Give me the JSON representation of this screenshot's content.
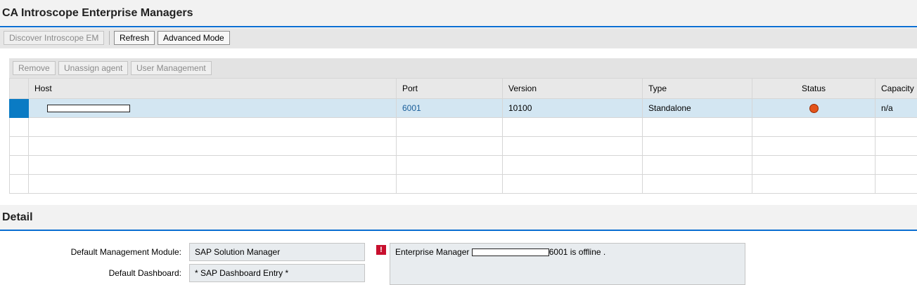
{
  "sections": {
    "managers_title": "CA Introscope Enterprise Managers",
    "detail_title": "Detail"
  },
  "toolbar": {
    "discover_label": "Discover Introscope EM",
    "refresh_label": "Refresh",
    "advanced_label": "Advanced Mode"
  },
  "table_toolbar": {
    "remove_label": "Remove",
    "unassign_label": "Unassign agent",
    "user_mgmt_label": "User Management"
  },
  "table": {
    "columns": [
      "Host",
      "Port",
      "Version",
      "Type",
      "Status",
      "Capacity"
    ],
    "rows": [
      {
        "host": "",
        "port": "6001",
        "version": "10100",
        "type": "Standalone",
        "status": "offline-red-dot",
        "capacity": "n/a"
      }
    ],
    "empty_rows": 4
  },
  "detail": {
    "module_label": "Default Management Module:",
    "module_value": "SAP Solution Manager",
    "dashboard_label": "Default Dashboard:",
    "dashboard_value": "* SAP Dashboard Entry *",
    "message_prefix": "Enterprise Manager",
    "message_suffix": "6001 is offline .",
    "error_icon": "!"
  },
  "colors": {
    "accent": "#0a6ed1",
    "selection": "#0a7bc4",
    "row_selected": "#d3e6f2",
    "status_offline": "#e3541b",
    "error": "#c8102e"
  }
}
